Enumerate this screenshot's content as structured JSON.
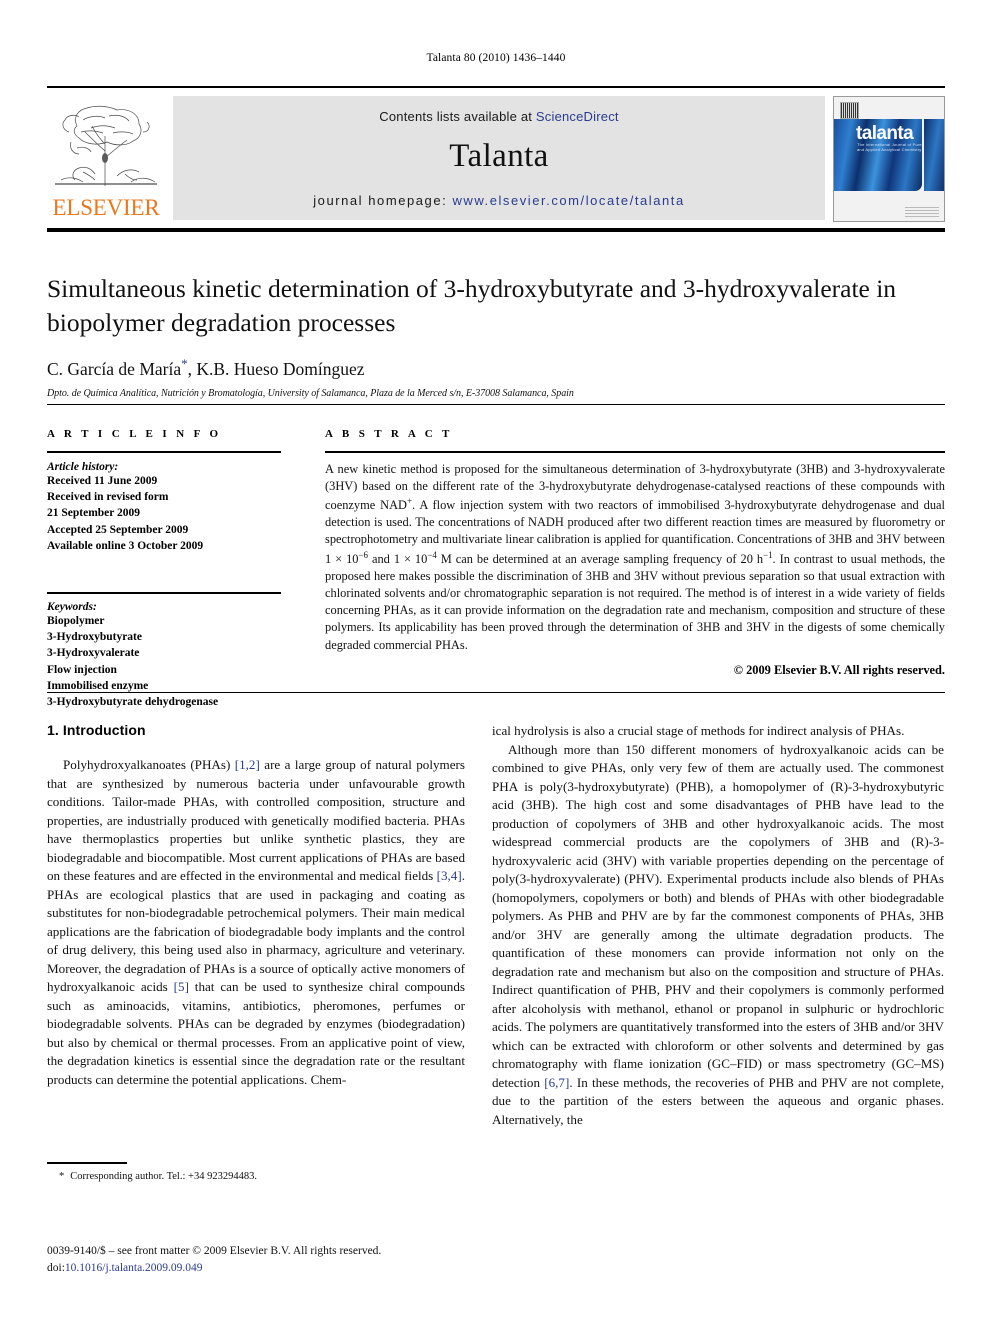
{
  "running_head": "Talanta 80 (2010) 1436–1440",
  "masthead": {
    "publisher_name": "ELSEVIER",
    "contents_prefix": "Contents lists available at ",
    "sciencedirect": "ScienceDirect",
    "journal_name": "Talanta",
    "homepage_prefix": "journal homepage: ",
    "homepage_url": "www.elsevier.com/locate/talanta",
    "cover_title": "talanta",
    "cover_subtitle": "The International Journal of Pure and Applied Analytical Chemistry",
    "link_color": "#2a3b8f",
    "elsevier_orange": "#E8791E"
  },
  "title_block": {
    "title": "Simultaneous kinetic determination of 3-hydroxybutyrate and 3-hydroxyvalerate in biopolymer degradation processes",
    "authors": "C. García de María",
    "authors_rest": ", K.B. Hueso Domínguez",
    "corresponding_marker": "*",
    "affiliation": "Dpto. de Química Analítica, Nutrición y Bromatología, University of Salamanca, Plaza de la Merced s/n, E-37008 Salamanca, Spain"
  },
  "article_info": {
    "heading": "A R T I C L E   I N F O",
    "history_label": "Article history:",
    "history": [
      "Received 11 June 2009",
      "Received in revised form",
      "21 September 2009",
      "Accepted 25 September 2009",
      "Available online 3 October 2009"
    ],
    "keywords_label": "Keywords:",
    "keywords": [
      "Biopolymer",
      "3-Hydroxybutyrate",
      "3-Hydroxyvalerate",
      "Flow injection",
      "Immobilised enzyme",
      "3-Hydroxybutyrate dehydrogenase"
    ]
  },
  "abstract": {
    "heading": "A B S T R A C T",
    "paragraph_1": "A new kinetic method is proposed for the simultaneous determination of 3-hydroxybutyrate (3HB) and 3-hydroxyvalerate (3HV) based on the different rate of the 3-hydroxybutyrate dehydrogenase-catalysed reactions of these compounds with coenzyme NAD",
    "nad_sup": "+",
    "paragraph_2": ". A flow injection system with two reactors of immobilised 3-hydroxybutyrate dehydrogenase and dual detection is used. The concentrations of NADH produced after two different reaction times are measured by fluorometry or spectrophotometry and multivariate linear calibration is applied for quantification. Concentrations of 3HB and 3HV between 1 × 10",
    "exp1": "−6",
    "paragraph_3": " and 1 × 10",
    "exp2": "−4",
    "paragraph_4": " M can be determined at an average sampling frequency of 20 h",
    "exp3": "−1",
    "paragraph_5": ". In contrast to usual methods, the proposed here makes possible the discrimination of 3HB and 3HV without previous separation so that usual extraction with chlorinated solvents and/or chromatographic separation is not required. The method is of interest in a wide variety of fields concerning PHAs, as it can provide information on the degradation rate and mechanism, composition and structure of these polymers. Its applicability has been proved through the determination of 3HB and 3HV in the digests of some chemically degraded commercial PHAs.",
    "copyright": "© 2009 Elsevier B.V. All rights reserved."
  },
  "body": {
    "section_heading": "1. Introduction",
    "left_par_1_a": "Polyhydroxyalkanoates (PHAs) ",
    "left_ref_1": "[1,2]",
    "left_par_1_b": " are a large group of natural polymers that are synthesized by numerous bacteria under unfavourable growth conditions. Tailor-made PHAs, with controlled composition, structure and properties, are industrially produced with genetically modified bacteria. PHAs have thermoplastics properties but unlike synthetic plastics, they are biodegradable and biocompatible. Most current applications of PHAs are based on these features and are effected in the environmental and medical fields ",
    "left_ref_2": "[3,4]",
    "left_par_1_c": ". PHAs are ecological plastics that are used in packaging and coating as substitutes for non-biodegradable petrochemical polymers. Their main medical applications are the fabrication of biodegradable body implants and the control of drug delivery, this being used also in pharmacy, agriculture and veterinary. Moreover, the degradation of PHAs is a source of optically active monomers of hydroxyalkanoic acids ",
    "left_ref_3": "[5]",
    "left_par_1_d": " that can be used to synthesize chiral compounds such as aminoacids, vitamins, antibiotics, pheromones, perfumes or biodegradable solvents. PHAs can be degraded by enzymes (biodegradation) but also by chemical or thermal processes. From an applicative point of view, the degradation kinetics is essential since the degradation rate or the resultant products can determine the potential applications. Chem-",
    "right_par_cont": "ical hydrolysis is also a crucial stage of methods for indirect analysis of PHAs.",
    "right_par_2_a": "Although more than 150 different monomers of hydroxyalkanoic acids can be combined to give PHAs, only very few of them are actually used. The commonest PHA is poly(3-hydroxybutyrate) (PHB), a homopolymer of (R)-3-hydroxybutyric acid (3HB). The high cost and some disadvantages of PHB have lead to the production of copolymers of 3HB and other hydroxyalkanoic acids. The most widespread commercial products are the copolymers of 3HB and (R)-3-hydroxyvaleric acid (3HV) with variable properties depending on the percentage of poly(3-hydroxyvalerate) (PHV). Experimental products include also blends of PHAs (homopolymers, copolymers or both) and blends of PHAs with other biodegradable polymers. As PHB and PHV are by far the commonest components of PHAs, 3HB and/or 3HV are generally among the ultimate degradation products. The quantification of these monomers can provide information not only on the degradation rate and mechanism but also on the composition and structure of PHAs. Indirect quantification of PHB, PHV and their copolymers is commonly performed after alcoholysis with methanol, ethanol or propanol in sulphuric or hydrochloric acids. The polymers are quantitatively transformed into the esters of 3HB and/or 3HV which can be extracted with chloroform or other solvents and determined by gas chromatography with flame ionization (GC–FID) or mass spectrometry (GC–MS) detection ",
    "right_ref_1": "[6,7]",
    "right_par_2_b": ". In these methods, the recoveries of PHB and PHV are not complete, due to the partition of the esters between the aqueous and organic phases. Alternatively, the"
  },
  "footer": {
    "corresponding_star": "*",
    "corresponding_note": "Corresponding author. Tel.: +34 923294483.",
    "issn_line": "0039-9140/$ – see front matter © 2009 Elsevier B.V. All rights reserved.",
    "doi_label": "doi:",
    "doi_value": "10.1016/j.talanta.2009.09.049"
  }
}
